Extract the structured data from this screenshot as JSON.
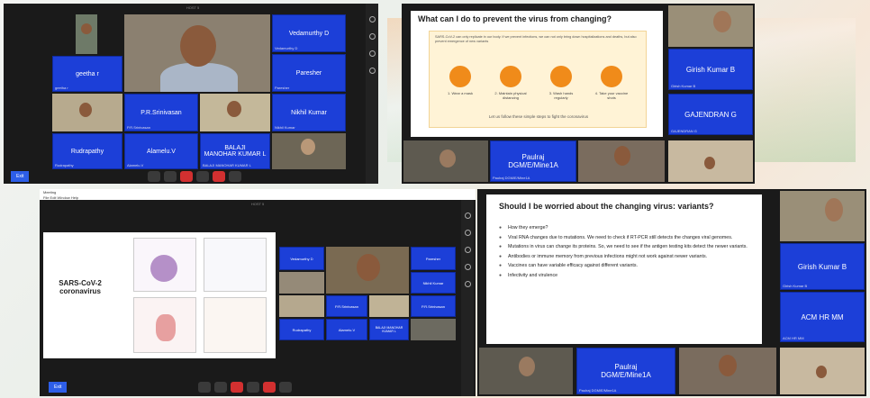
{
  "panel1": {
    "host": "HOST 5",
    "tiles": [
      {
        "label": "geetha r",
        "sub": "geetha r"
      },
      {
        "label": "Vedamurthy D",
        "sub": "Vedamurthy D"
      },
      {
        "label": "Paresher",
        "sub": "Paresher"
      },
      {
        "label": "Nikhil Kumar",
        "sub": "Nikhil Kumar"
      },
      {
        "label": "P.R.Srinivasan",
        "sub": "P.R.Srinivasan"
      },
      {
        "label": "Rudrapathy",
        "sub": "Rudrapathy"
      },
      {
        "label": "Alamelu.V",
        "sub": "Alamelu.V"
      },
      {
        "label": "BALAJI\nMANOHAR KUMAR L",
        "sub": "BALAJI MANOHAR KUMAR L"
      }
    ],
    "leave": "Exit"
  },
  "panel2": {
    "slide_title": "What can I do to prevent the virus from changing?",
    "intro": "SARS-CoV-2 can only replicate in our body. If we prevent infections, we can not only bring down hospitalizations and deaths, but also prevent emergence of new variants",
    "steps": [
      "1. Wear a mask",
      "2. Maintain physical distancing",
      "3. Wash hands regularly",
      "4. Take your vaccine shots"
    ],
    "footer": "Let us follow these simple steps to fight the coronavirus",
    "right_tiles": [
      "Girish Kumar B",
      "GAJENDRAN G"
    ],
    "right_sub": [
      "Girish Kumar B",
      "GAJENDRAN G"
    ],
    "bottom_tile": "Paulraj\nDGM/E/Mine1A",
    "bottom_sub": "Paulraj DGM/E/Mine1A"
  },
  "panel3": {
    "window_title": "Meeting",
    "menu": "File  Edit  Window  Help",
    "host": "HOST 5",
    "slide_title": "SARS-CoV-2\ncoronavirus",
    "tiles": [
      "Vedamurthy D",
      "Paresher",
      "Nikhil Kumar",
      "P.R.Srinivasan",
      "Rudrapathy",
      "Alamelu.V",
      "BALAJI MANOHAR KUMAR L"
    ],
    "leave": "Exit"
  },
  "panel4": {
    "slide_title": "Should I be worried about the changing virus: variants?",
    "bullets": [
      "How they emerge?",
      "Viral RNA changes due to mutations. We need to check if RT-PCR still detects the changes viral genomes.",
      "Mutations in virus can change its proteins. So, we need to see if the antigen testing kits detect the newer variants.",
      "Antibodies or immune memory from previous infections might not work against newer variants.",
      "Vaccines can have variable efficacy against different variants.",
      "Infectivity and virulence"
    ],
    "right_tiles": [
      "Girish Kumar B",
      "ACM HR MM"
    ],
    "right_sub": [
      "Girish Kumar B",
      "ACM HR MM"
    ],
    "bottom_tile": "Paulraj\nDGM/E/Mine1A",
    "bottom_sub": "Paulraj DGM/E/Mine1A"
  }
}
